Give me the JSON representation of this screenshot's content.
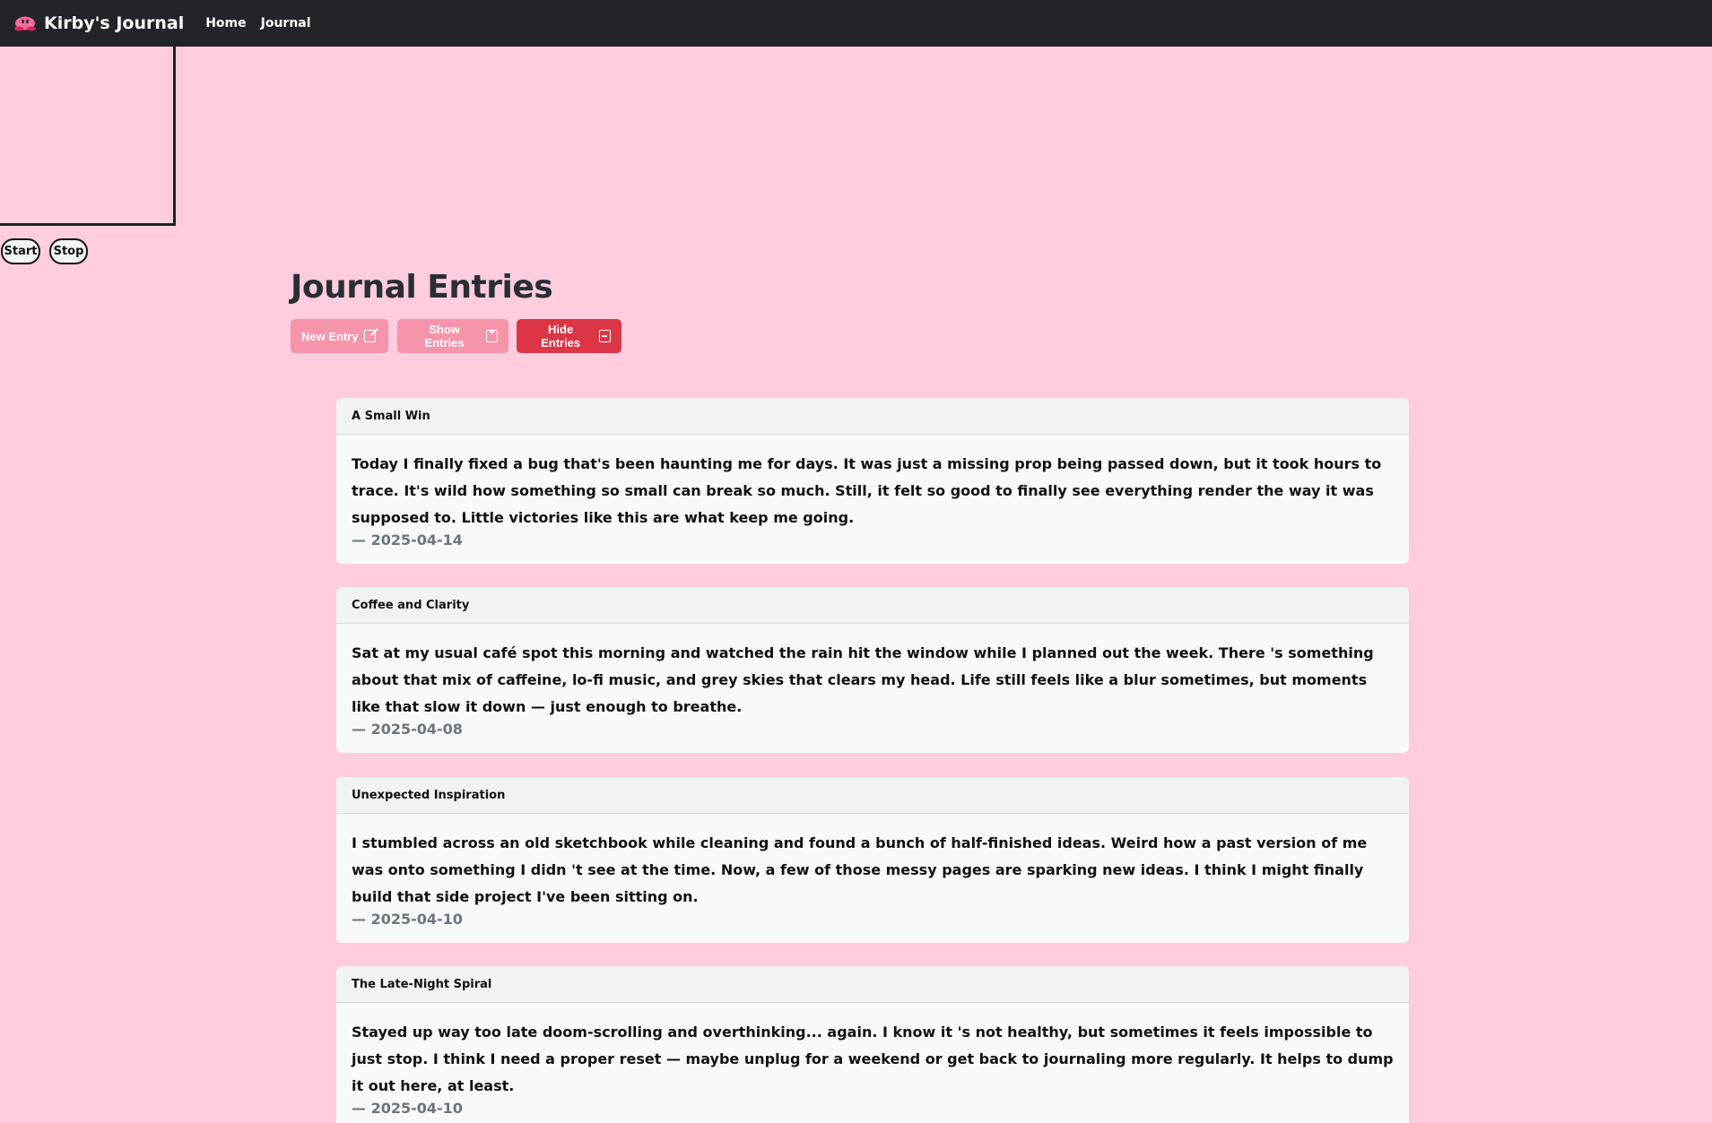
{
  "navbar": {
    "brand": "Kirby's Journal",
    "links": [
      "Home",
      "Journal"
    ]
  },
  "controls": {
    "start": "Start",
    "stop": "Stop"
  },
  "main": {
    "title": "Journal Entries",
    "buttons": {
      "new_entry": "New Entry",
      "show_entries": "Show Entries",
      "hide_entries": "Hide Entries"
    }
  },
  "entries": [
    {
      "title": "A Small Win",
      "body": "Today I finally fixed a bug that's been haunting me for days. It was just a missing prop being passed down, but it took hours to trace. It's wild how something so small can break so much. Still, it felt so good to finally see everything render the way it was supposed to. Little victories like this are what keep me going.",
      "date": "— 2025-04-14"
    },
    {
      "title": "Coffee and Clarity",
      "body": "Sat at my usual café spot this morning and watched the rain hit the window while I planned out the week. There 's something about that mix of caffeine, lo-fi music, and grey skies that clears my head. Life still feels like a blur sometimes, but moments like that slow it down — just enough to breathe.",
      "date": "— 2025-04-08"
    },
    {
      "title": "Unexpected Inspiration",
      "body": "I stumbled across an old sketchbook while cleaning and found a bunch of half-finished ideas. Weird how a past version of me was onto something I didn 't see at the time. Now, a few of those messy pages are sparking new ideas. I think I might finally build that side project I've been sitting on.",
      "date": "— 2025-04-10"
    },
    {
      "title": "The Late-Night Spiral",
      "body": "Stayed up way too late doom-scrolling and overthinking... again. I know it 's not healthy, but sometimes it feels impossible to just stop. I think I need a proper reset — maybe unplug for a weekend or get back to journaling more regularly. It helps to dump it out here, at least.",
      "date": "— 2025-04-10"
    }
  ],
  "colors": {
    "page_bg": "#ffcddd",
    "navbar_bg": "#212529",
    "pink_button": "#f694ab",
    "danger_button": "#dc3545"
  }
}
